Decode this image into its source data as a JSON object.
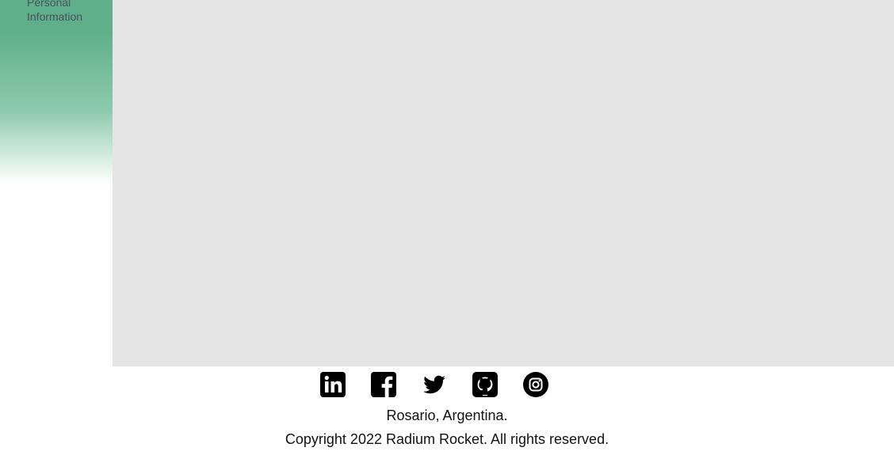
{
  "sidebar": {
    "items": [
      {
        "label": "Personal Information"
      }
    ]
  },
  "footer": {
    "social": [
      {
        "name": "LinkedIn",
        "icon": "linkedin-icon"
      },
      {
        "name": "Facebook",
        "icon": "facebook-icon"
      },
      {
        "name": "Twitter",
        "icon": "twitter-icon"
      },
      {
        "name": "GitHub",
        "icon": "github-icon"
      },
      {
        "name": "Instagram",
        "icon": "instagram-icon"
      }
    ],
    "location": "Rosario, Argentina.",
    "copyright": "Copyright 2022 Radium Rocket. All rights reserved."
  },
  "colors": {
    "sidebar_accent": "#5fb08a",
    "content_background": "#e5e5e5",
    "sidebar_text": "#4a4f63"
  }
}
